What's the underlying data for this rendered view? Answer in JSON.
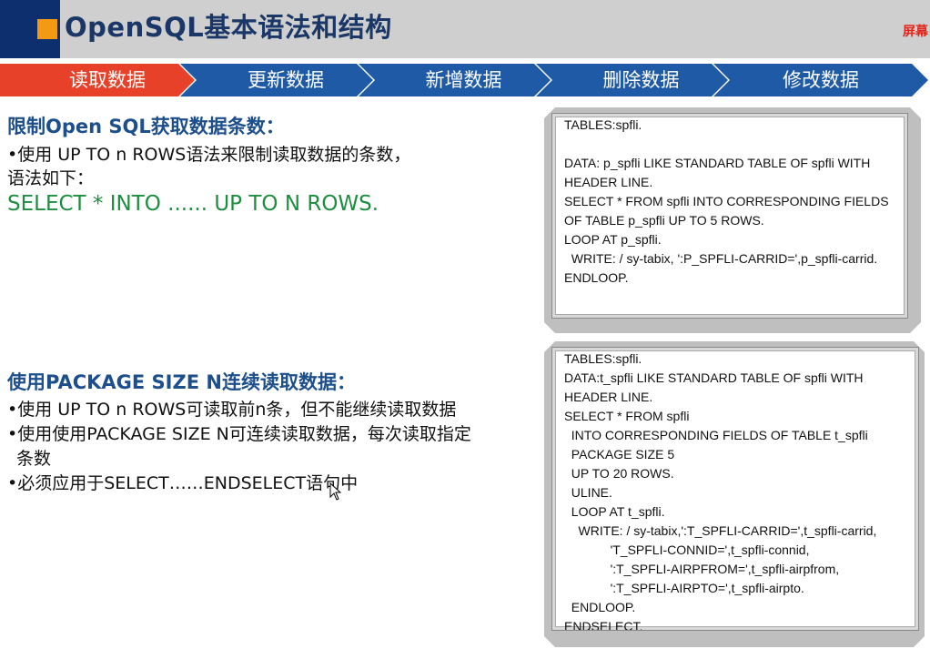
{
  "header": {
    "title": "OpenSQL基本语法和结构",
    "screen_label": "屏幕"
  },
  "nav": {
    "active_color": "#e8412a",
    "inactive_color": "#1f5aa6",
    "items": [
      {
        "label": "读取数据",
        "active": true
      },
      {
        "label": "更新数据",
        "active": false
      },
      {
        "label": "新增数据",
        "active": false
      },
      {
        "label": "删除数据",
        "active": false
      },
      {
        "label": "修改数据",
        "active": false
      }
    ]
  },
  "section1": {
    "title": "限制Open SQL获取数据条数：",
    "lines": [
      "•使用 UP TO n ROWS语法来限制读取数据的条数，",
      "语法如下："
    ],
    "syntax": "SELECT * INTO ...... UP TO N ROWS."
  },
  "section2": {
    "title": "使用PACKAGE SIZE N连续读取数据：",
    "lines": [
      "•使用 UP TO n ROWS可读取前n条，但不能继续读取数据",
      "•使用使用PACKAGE SIZE N可连续读取数据，每次读取指定",
      "条数",
      "•必须应用于SELECT……ENDSELECT语句中"
    ]
  },
  "code1": {
    "lines": [
      "TABLES:spfli.",
      "",
      "DATA: p_spfli LIKE STANDARD TABLE OF spfli WITH",
      "HEADER LINE.",
      "SELECT * FROM spfli INTO CORRESPONDING FIELDS",
      "OF TABLE p_spfli UP TO 5 ROWS.",
      "LOOP AT p_spfli.",
      "  WRITE: / sy-tabix, ':P_SPFLI-CARRID=',p_spfli-carrid.",
      "ENDLOOP."
    ]
  },
  "code2": {
    "lines": [
      "TABLES:spfli.",
      "DATA:t_spfli LIKE STANDARD TABLE OF spfli WITH",
      "HEADER LINE.",
      "SELECT * FROM spfli",
      "  INTO CORRESPONDING FIELDS OF TABLE t_spfli",
      "  PACKAGE SIZE 5",
      "  UP TO 20 ROWS.",
      "  ULINE.",
      "  LOOP AT t_spfli.",
      "    WRITE: / sy-tabix,':T_SPFLI-CARRID=',t_spfli-carrid,",
      "             'T_SPFLI-CONNID=',t_spfli-connid,",
      "             ':T_SPFLI-AIRPFROM=',t_spfli-airpfrom,",
      "             ':T_SPFLI-AIRPTO=',t_spfli-airpto.",
      "  ENDLOOP.",
      "ENDSELECT."
    ]
  }
}
